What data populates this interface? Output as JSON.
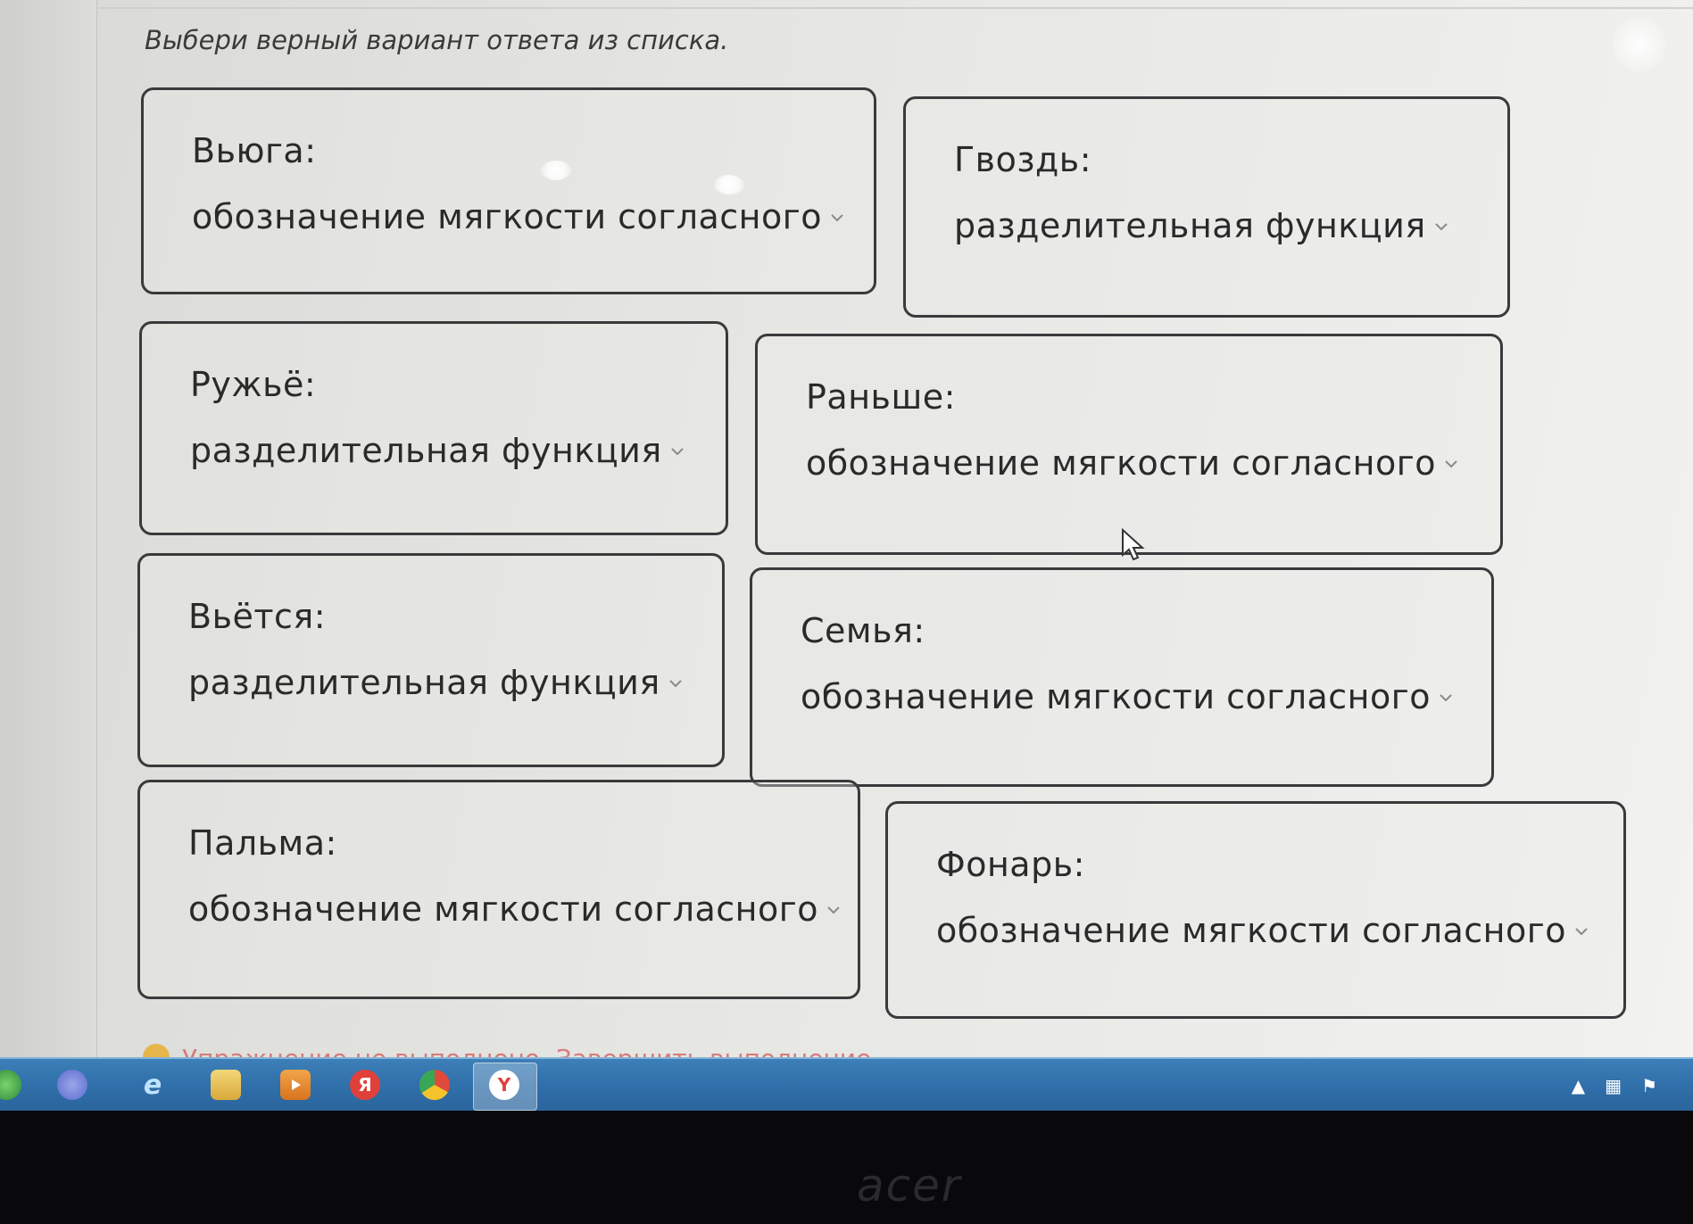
{
  "instruction": "Выбери верный вариант ответа из списка.",
  "cards": [
    {
      "word": "Вьюга:",
      "value": "обозначение мягкости согласного"
    },
    {
      "word": "Гвоздь:",
      "value": "разделительная функция"
    },
    {
      "word": "Ружьё:",
      "value": "разделительная функция"
    },
    {
      "word": "Раньше:",
      "value": "обозначение мягкости согласного"
    },
    {
      "word": "Вьётся:",
      "value": "разделительная функция"
    },
    {
      "word": "Семья:",
      "value": "обозначение мягкости согласного"
    },
    {
      "word": "Пальма:",
      "value": "обозначение мягкости согласного"
    },
    {
      "word": "Фонарь:",
      "value": "обозначение мягкости согласного"
    }
  ],
  "status": {
    "message": "Упражнение не выполнено. Завершить выполнение"
  },
  "taskbar": {
    "icons": [
      "browser-icon",
      "ie-icon",
      "folder-icon",
      "media-player-icon",
      "yandex-icon",
      "chrome-icon",
      "yandex-browser-icon"
    ],
    "yandex_label": "Я",
    "ybrowser_label": "Y"
  },
  "monitor": {
    "logo": "acer"
  },
  "colors": {
    "card_border": "#3a3a3c",
    "text": "#2a2a2a",
    "taskbar": "#2f6ea8"
  }
}
